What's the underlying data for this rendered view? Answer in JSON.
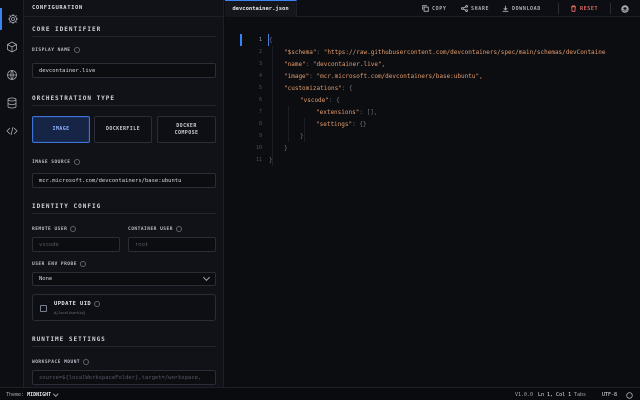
{
  "rail": {
    "items": [
      {
        "icon": "gear-icon",
        "active": true
      },
      {
        "icon": "cube-icon",
        "active": false
      },
      {
        "icon": "globe-icon",
        "active": false
      },
      {
        "icon": "database-icon",
        "active": false
      },
      {
        "icon": "code-icon",
        "active": false
      }
    ]
  },
  "panel": {
    "title": "CONFIGURATION",
    "core": {
      "heading": "CORE IDENTIFIER",
      "display_name_label": "DISPLAY NAME",
      "display_name_value": "devcontainer.live"
    },
    "orchestration": {
      "heading": "ORCHESTRATION TYPE",
      "options": [
        {
          "label": "IMAGE",
          "active": true
        },
        {
          "label": "DOCKERFILE",
          "active": false
        },
        {
          "label": "DOCKER COMPOSE",
          "active": false
        }
      ],
      "image_source_label": "IMAGE SOURCE",
      "image_source_value": "mcr.microsoft.com/devcontainers/base:ubuntu"
    },
    "identity": {
      "heading": "IDENTITY CONFIG",
      "remote_user_label": "REMOTE USER",
      "remote_user_placeholder": "vscode",
      "container_user_label": "CONTAINER USER",
      "container_user_placeholder": "root",
      "env_probe_label": "USER ENV PROBE",
      "env_probe_value": "None",
      "update_uid_title": "UPDATE UID",
      "update_uid_sub": "#{localUserUid}"
    },
    "runtime": {
      "heading": "RUNTIME SETTINGS",
      "workspace_mount_label": "WORKSPACE MOUNT",
      "workspace_mount_placeholder": "source=${localWorkspaceFolder},target=/workspace,"
    }
  },
  "topbar": {
    "tab_label": "devcontainer.json",
    "copy_label": "COPY",
    "share_label": "SHARE",
    "download_label": "DOWNLOAD",
    "reset_label": "RESET",
    "reset_color": "#e2685d",
    "github_icon": "github-icon"
  },
  "editor": {
    "lines": [
      {
        "n": "1",
        "text": "{"
      },
      {
        "n": "2",
        "key": "\"$schema\"",
        "val": "\"https://raw.githubusercontent.com/devcontainers/spec/main/schemas/devContaine"
      },
      {
        "n": "3",
        "key": "\"name\"",
        "val": "\"devcontainer.live\","
      },
      {
        "n": "4",
        "key": "\"image\"",
        "val": "\"mcr.microsoft.com/devcontainers/base:ubuntu\","
      },
      {
        "n": "5",
        "key": "\"customizations\"",
        "val": "{"
      },
      {
        "n": "6",
        "key": "\"vscode\"",
        "val": "{"
      },
      {
        "n": "7",
        "key": "\"extensions\"",
        "val": "[],"
      },
      {
        "n": "8",
        "key": "\"settings\"",
        "val": "{}"
      },
      {
        "n": "9",
        "text": "}"
      },
      {
        "n": "10",
        "text": "}"
      },
      {
        "n": "11",
        "text": "}"
      }
    ]
  },
  "status": {
    "theme_label": "Theme:",
    "theme_value": "MIDNIGHT",
    "version": "V1.0.0",
    "position": "Ln 1, Col 1",
    "indent": "Tabs",
    "encoding": "UTF-8"
  },
  "colors": {
    "accent": "#3b82f6",
    "string": "#e49c6b",
    "background": "#0b0c10"
  }
}
